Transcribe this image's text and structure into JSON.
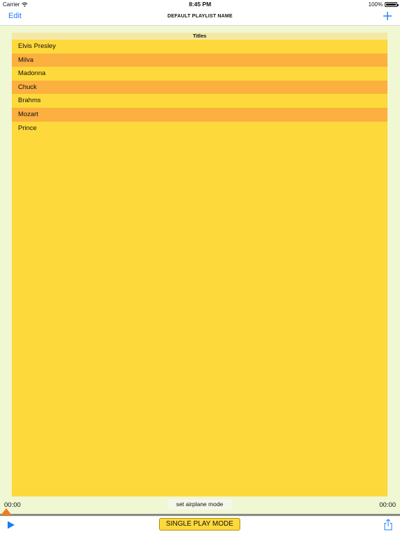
{
  "status": {
    "carrier": "Carrier",
    "time": "8:45 PM",
    "battery": "100%"
  },
  "nav": {
    "edit_label": "Edit",
    "title": "DEFAULT PLAYLIST NAME"
  },
  "table": {
    "header": "Titles",
    "rows": [
      "Elvis Presley",
      "Milva",
      "Madonna",
      "Chuck",
      "Brahms",
      "Mozart",
      "Prince"
    ]
  },
  "player": {
    "time_elapsed": "00:00",
    "time_total": "00:00",
    "airplane_label": "set airplane mode",
    "mode_label": "SINGLE PLAY MODE",
    "progress": 0
  },
  "colors": {
    "accent": "#1a7cf7",
    "row_primary": "#fed93b",
    "row_alternate": "#fbb03f",
    "background": "#f0f7d3",
    "progress_thumb": "#f37a20"
  },
  "icons": [
    "wifi-icon",
    "battery-icon",
    "plus-icon",
    "play-icon",
    "share-icon"
  ]
}
